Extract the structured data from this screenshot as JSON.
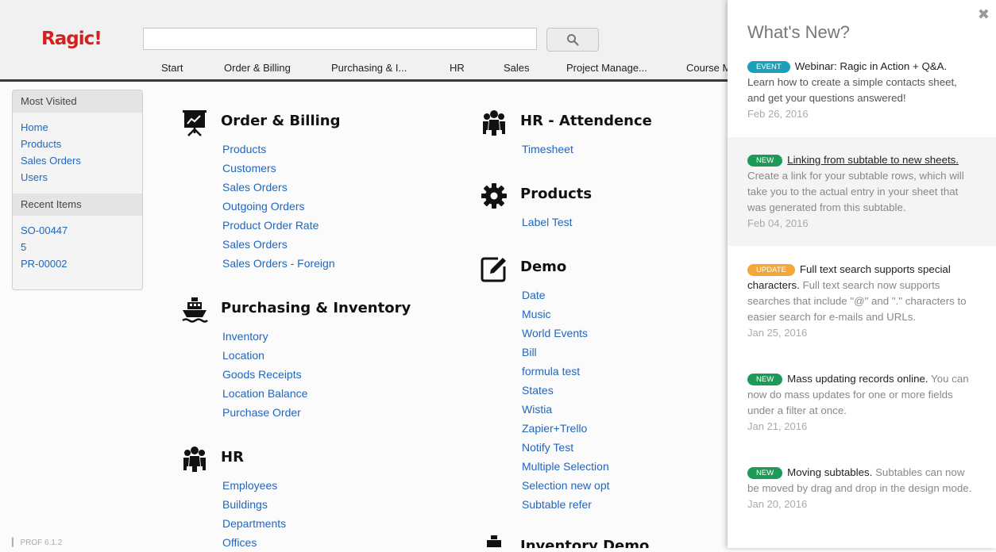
{
  "app": {
    "logo": "Ragic!",
    "version": "PROF 6.1.2"
  },
  "search": {
    "placeholder": ""
  },
  "tabs": [
    "Start",
    "Order & Billing",
    "Purchasing & I...",
    "HR",
    "Sales",
    "Project Manage...",
    "Course M"
  ],
  "sidebar": {
    "most_visited_title": "Most Visited",
    "most_visited": [
      "Home",
      "Products",
      "Sales Orders",
      "Users"
    ],
    "recent_title": "Recent Items",
    "recent": [
      "SO-00447",
      "5",
      "PR-00002"
    ]
  },
  "groups": {
    "order_billing": {
      "title": "Order & Billing",
      "icon": "presentation-chart-icon",
      "links": [
        "Products",
        "Customers",
        "Sales Orders",
        "Outgoing Orders",
        "Product Order Rate",
        "Sales Orders",
        "Sales Orders - Foreign"
      ]
    },
    "purchasing": {
      "title": "Purchasing & Inventory",
      "icon": "ship-icon",
      "links": [
        "Inventory",
        "Location",
        "Goods Receipts",
        "Location Balance",
        "Purchase Order"
      ]
    },
    "hr": {
      "title": "HR",
      "icon": "people-icon",
      "links": [
        "Employees",
        "Buildings",
        "Departments",
        "Offices"
      ]
    },
    "hr_attendence": {
      "title": "HR - Attendence",
      "icon": "people-icon",
      "links": [
        "Timesheet"
      ]
    },
    "products": {
      "title": "Products",
      "icon": "gear-icon",
      "links": [
        "Label Test"
      ]
    },
    "demo": {
      "title": "Demo",
      "icon": "edit-icon",
      "links": [
        "Date",
        "Music",
        "World Events",
        "Bill",
        "formula test",
        "States",
        "Wistia",
        "Zapier+Trello",
        "Notify Test",
        "Multiple Selection",
        "Selection new opt",
        "Subtable refer"
      ]
    },
    "inventory_demo": {
      "title": "Inventory Demo",
      "icon": "ship-icon"
    }
  },
  "whats_new": {
    "title": "What's New?",
    "items": [
      {
        "badge": "EVENT",
        "title": "Webinar: Ragic in Action + Q&A.",
        "desc": "Learn how to create a simple contacts sheet, and get your questions answered!",
        "date": "Feb 26, 2016"
      },
      {
        "badge": "NEW",
        "title": "Linking from subtable to new sheets.",
        "desc": "Create a link for your subtable rows, which will take you to the actual entry in your sheet that was generated from this subtable.",
        "date": "Feb 04, 2016"
      },
      {
        "badge": "UPDATE",
        "title": "Full text search supports special characters.",
        "desc": "Full text search now supports searches that include \"@\" and \".\" characters to easier search for e-mails and URLs.",
        "date": "Jan 25, 2016"
      },
      {
        "badge": "NEW",
        "title": "Mass updating records online.",
        "desc": "You can now do mass updates for one or more fields under a filter at once.",
        "date": "Jan 21, 2016"
      },
      {
        "badge": "NEW",
        "title": "Moving subtables.",
        "desc": "Subtables can now be moved by drag and drop in the design mode.",
        "date": "Jan 20, 2016"
      }
    ]
  }
}
